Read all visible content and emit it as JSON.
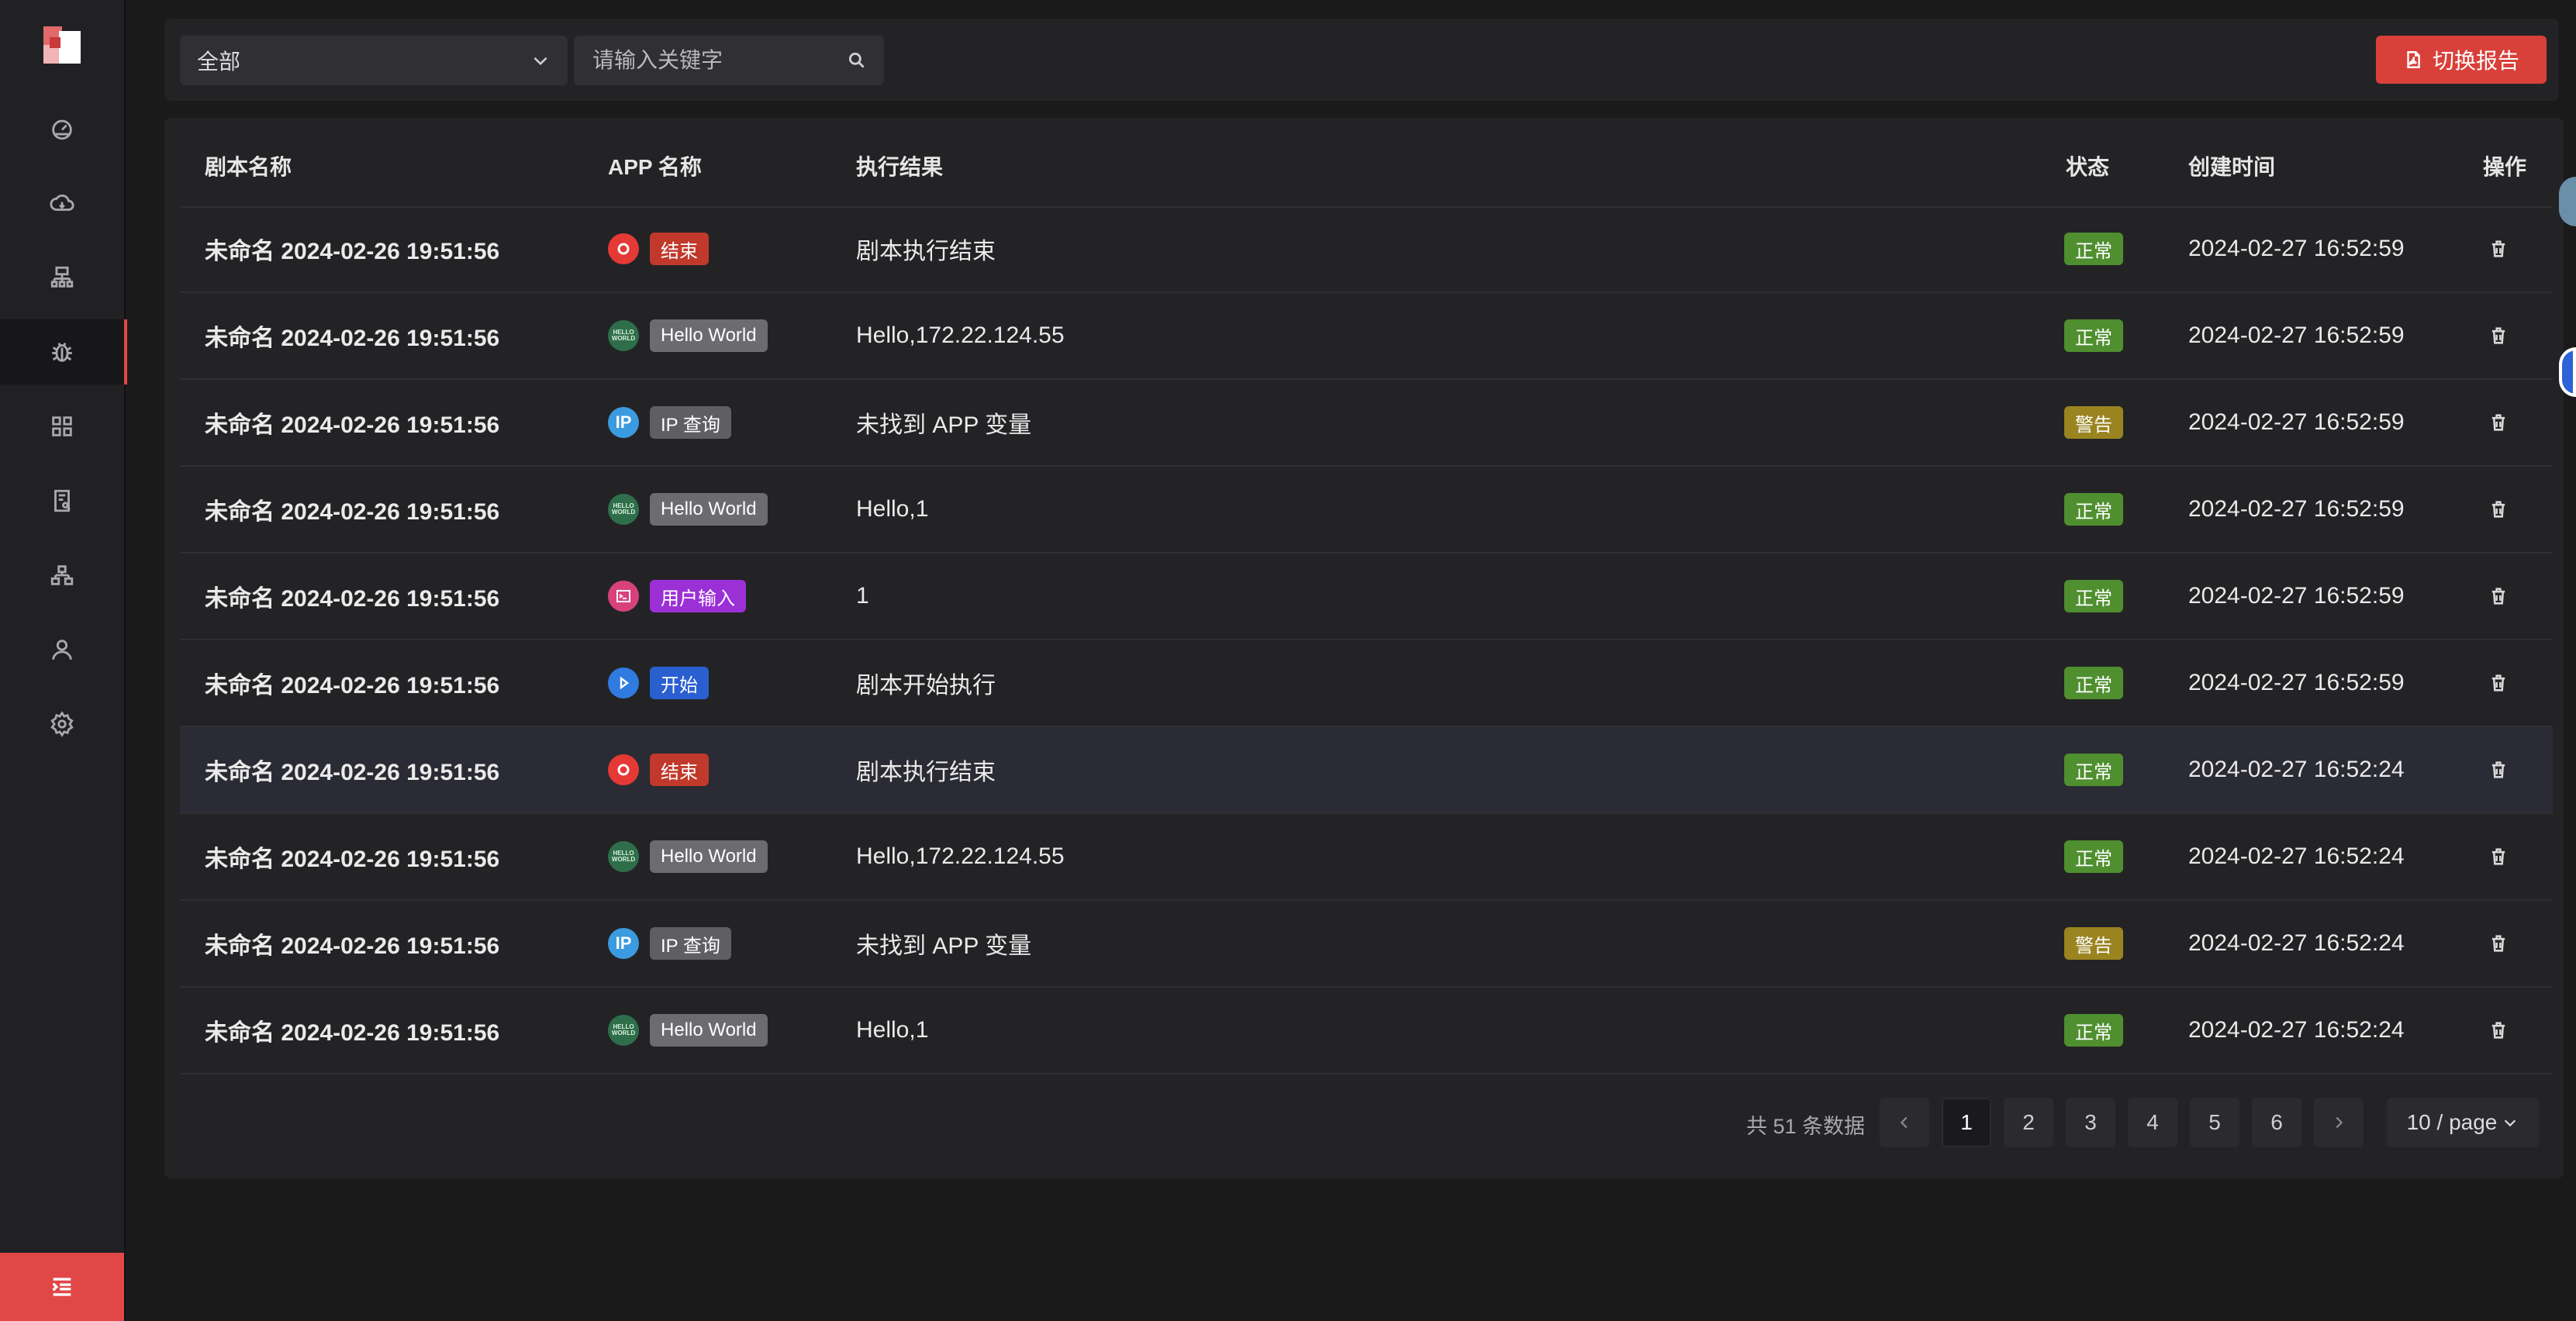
{
  "colors": {
    "accent": "#d9403a",
    "normal": "#4f8f2f",
    "warning": "#9a8420",
    "highlight_row": "#2a2b34"
  },
  "sidebar": {
    "items": [
      {
        "icon": "dashboard-icon"
      },
      {
        "icon": "cloud-icon"
      },
      {
        "icon": "network-icon"
      },
      {
        "icon": "bug-icon"
      },
      {
        "icon": "apps-grid-icon"
      },
      {
        "icon": "report-icon"
      },
      {
        "icon": "hierarchy-icon"
      },
      {
        "icon": "user-icon"
      },
      {
        "icon": "settings-icon"
      }
    ],
    "active_index": 3,
    "collapse_icon": "menu-collapse-icon"
  },
  "filter": {
    "select_value": "全部",
    "search_placeholder": "请输入关键字",
    "report_button": "切换报告"
  },
  "table": {
    "headers": [
      "剧本名称",
      "APP 名称",
      "执行结果",
      "状态",
      "创建时间",
      "操作"
    ],
    "rows": [
      {
        "name": "未命名 2024-02-26 19:51:56",
        "app": "结束",
        "app_type": "end",
        "result": "剧本执行结束",
        "status": "正常",
        "status_type": "normal",
        "created": "2024-02-27 16:52:59"
      },
      {
        "name": "未命名 2024-02-26 19:51:56",
        "app": "Hello World",
        "app_type": "hello",
        "result": "Hello,172.22.124.55",
        "status": "正常",
        "status_type": "normal",
        "created": "2024-02-27 16:52:59"
      },
      {
        "name": "未命名 2024-02-26 19:51:56",
        "app": "IP 查询",
        "app_type": "ip",
        "result": "未找到 APP 变量",
        "status": "警告",
        "status_type": "warning",
        "created": "2024-02-27 16:52:59"
      },
      {
        "name": "未命名 2024-02-26 19:51:56",
        "app": "Hello World",
        "app_type": "hello",
        "result": "Hello,1",
        "status": "正常",
        "status_type": "normal",
        "created": "2024-02-27 16:52:59"
      },
      {
        "name": "未命名 2024-02-26 19:51:56",
        "app": "用户输入",
        "app_type": "input",
        "result": "1",
        "status": "正常",
        "status_type": "normal",
        "created": "2024-02-27 16:52:59"
      },
      {
        "name": "未命名 2024-02-26 19:51:56",
        "app": "开始",
        "app_type": "start",
        "result": "剧本开始执行",
        "status": "正常",
        "status_type": "normal",
        "created": "2024-02-27 16:52:59"
      },
      {
        "name": "未命名 2024-02-26 19:51:56",
        "app": "结束",
        "app_type": "end",
        "result": "剧本执行结束",
        "status": "正常",
        "status_type": "normal",
        "created": "2024-02-27 16:52:24"
      },
      {
        "name": "未命名 2024-02-26 19:51:56",
        "app": "Hello World",
        "app_type": "hello",
        "result": "Hello,172.22.124.55",
        "status": "正常",
        "status_type": "normal",
        "created": "2024-02-27 16:52:24"
      },
      {
        "name": "未命名 2024-02-26 19:51:56",
        "app": "IP 查询",
        "app_type": "ip",
        "result": "未找到 APP 变量",
        "status": "警告",
        "status_type": "warning",
        "created": "2024-02-27 16:52:24"
      },
      {
        "name": "未命名 2024-02-26 19:51:56",
        "app": "Hello World",
        "app_type": "hello",
        "result": "Hello,1",
        "status": "正常",
        "status_type": "normal",
        "created": "2024-02-27 16:52:24"
      }
    ],
    "highlighted_row_index": 6
  },
  "pagination": {
    "total_text": "共 51 条数据",
    "pages": [
      "1",
      "2",
      "3",
      "4",
      "5",
      "6"
    ],
    "current_page": "1",
    "page_size": "10 / page"
  }
}
